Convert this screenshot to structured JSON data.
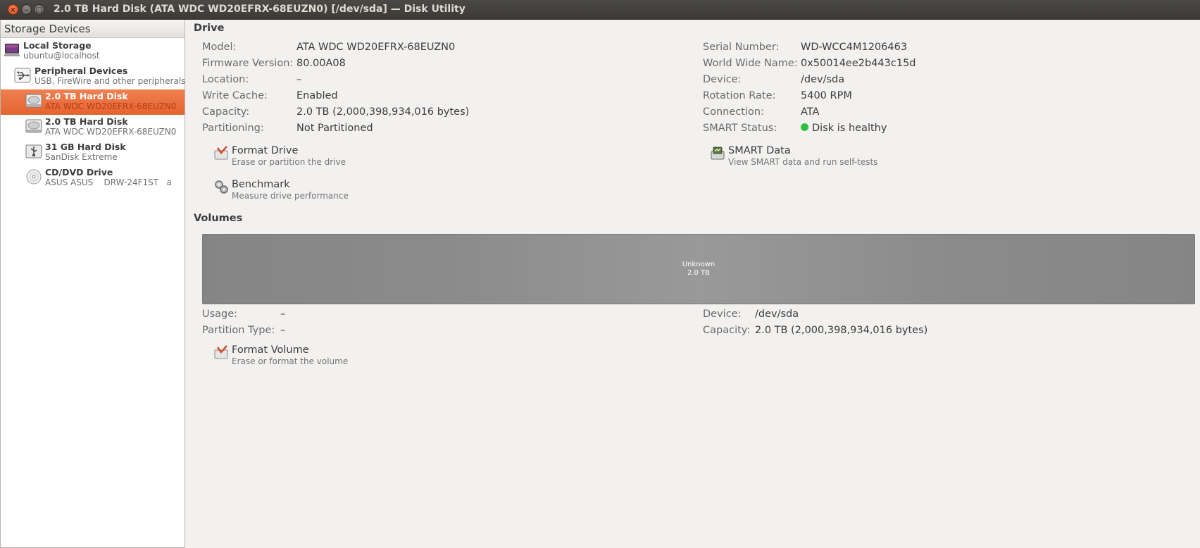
{
  "window": {
    "title": "2.0 TB Hard Disk (ATA WDC WD20EFRX-68EUZN0) [/dev/sda] — Disk Utility",
    "close_glyph": "×",
    "min_glyph": "–",
    "max_glyph": "□"
  },
  "sidebar": {
    "header": "Storage Devices",
    "items": [
      {
        "name": "Local Storage",
        "sub": "ubuntu@localhost",
        "icon": "computer-icon",
        "selected": false
      },
      {
        "name": "Peripheral Devices",
        "sub": "USB, FireWire and other peripherals",
        "icon": "usb-icon",
        "selected": false
      },
      {
        "name": "2.0 TB Hard Disk",
        "sub": "ATA WDC WD20EFRX-68EUZN0",
        "icon": "hard-disk-icon",
        "selected": true
      },
      {
        "name": "2.0 TB Hard Disk",
        "sub": "ATA WDC WD20EFRX-68EUZN0",
        "icon": "hard-disk-icon",
        "selected": false
      },
      {
        "name": "31 GB Hard Disk",
        "sub": "SanDisk Extreme",
        "icon": "usb-drive-icon",
        "selected": false
      },
      {
        "name": "CD/DVD Drive",
        "sub": "ASUS ASUS    DRW-24F1ST   a",
        "icon": "optical-drive-icon",
        "selected": false
      }
    ]
  },
  "drive": {
    "title": "Drive",
    "left_fields": [
      {
        "label": "Model:",
        "value": "ATA WDC WD20EFRX-68EUZN0"
      },
      {
        "label": "Firmware Version:",
        "value": "80.00A08"
      },
      {
        "label": "Location:",
        "value": "–"
      },
      {
        "label": "Write Cache:",
        "value": "Enabled"
      },
      {
        "label": "Capacity:",
        "value": "2.0 TB (2,000,398,934,016 bytes)"
      },
      {
        "label": "Partitioning:",
        "value": "Not Partitioned"
      }
    ],
    "right_fields": [
      {
        "label": "Serial Number:",
        "value": "WD-WCC4M1206463"
      },
      {
        "label": "World Wide Name:",
        "value": "0x50014ee2b443c15d"
      },
      {
        "label": "Device:",
        "value": "/dev/sda"
      },
      {
        "label": "Rotation Rate:",
        "value": "5400 RPM"
      },
      {
        "label": "Connection:",
        "value": "ATA"
      },
      {
        "label": "SMART Status:",
        "value": "Disk is healthy"
      }
    ],
    "smart_status_color": "#2fbf3a",
    "actions": {
      "format": {
        "title": "Format Drive",
        "desc": "Erase or partition the drive",
        "icon": "format-icon"
      },
      "benchmark": {
        "title": "Benchmark",
        "desc": "Measure drive performance",
        "icon": "gears-icon"
      },
      "smart": {
        "title": "SMART Data",
        "desc": "View SMART data and run self-tests",
        "icon": "smart-icon"
      }
    }
  },
  "volumes": {
    "title": "Volumes",
    "bar": {
      "line1": "Unknown",
      "line2": "2.0 TB"
    },
    "left_fields": [
      {
        "label": "Usage:",
        "value": "–"
      },
      {
        "label": "Partition Type:",
        "value": "–"
      }
    ],
    "right_fields": [
      {
        "label": "Device:",
        "value": "/dev/sda"
      },
      {
        "label": "Capacity:",
        "value": "2.0 TB (2,000,398,934,016 bytes)"
      }
    ],
    "actions": {
      "format": {
        "title": "Format Volume",
        "desc": "Erase or format the volume",
        "icon": "format-icon"
      }
    }
  },
  "colors": {
    "selection": "#e4632f",
    "accent_text": "#b53c18"
  }
}
